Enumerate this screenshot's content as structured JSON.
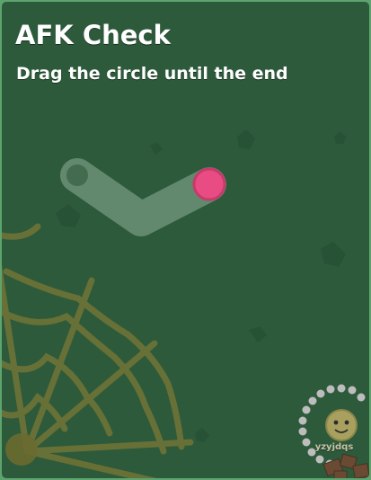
{
  "game": {
    "title": "AFK Check",
    "subtitle": "Drag the circle until the end",
    "player_name": "yzyjdqs"
  },
  "colors": {
    "background": "#2c5a3a",
    "border": "#5ea46f",
    "track": "#8fae98",
    "handle": "#e94c82",
    "handle_outline": "#c73a6c",
    "web": "#7a7a3e",
    "player_body": "#a8a05e",
    "petal": "#b8b8b8"
  },
  "icons": {
    "track_start": "ring-icon",
    "drag_handle": "circle-handle-icon",
    "decoration": "spider-web-icon",
    "player": "flower-player-icon"
  }
}
